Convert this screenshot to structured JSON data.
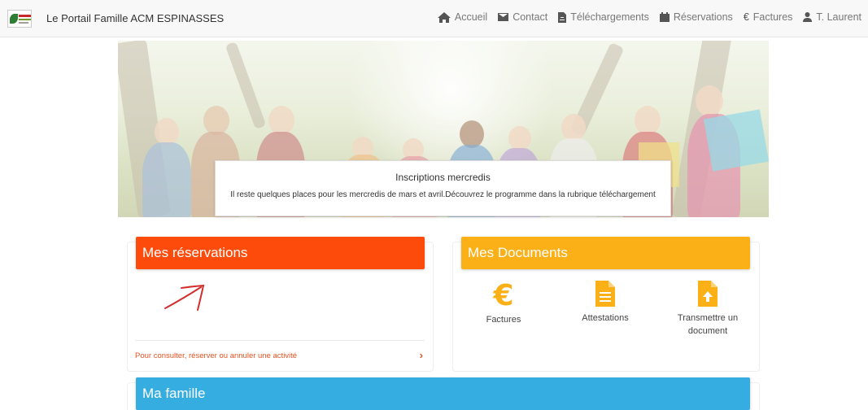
{
  "navbar": {
    "brand_title": "Le Portail Famille ACM ESPINASSES",
    "items": [
      {
        "label": "Accueil",
        "icon": "home-icon"
      },
      {
        "label": "Contact",
        "icon": "envelope-icon"
      },
      {
        "label": "Téléchargements",
        "icon": "file-download-icon"
      },
      {
        "label": "Réservations",
        "icon": "calendar-icon"
      },
      {
        "label": "Factures",
        "icon": "euro-icon"
      },
      {
        "label": "T. Laurent",
        "icon": "user-icon"
      }
    ]
  },
  "banner": {
    "title": "Inscriptions mercredis",
    "message": "Il reste quelques places pour les mercredis de mars et avril.Découvrez le programme dans la rubrique téléchargement"
  },
  "reservations": {
    "title": "Mes réservations",
    "link_text": "Pour consulter, réserver ou annuler une activité",
    "chevron": "›"
  },
  "documents": {
    "title": "Mes Documents",
    "items": [
      {
        "label": "Factures",
        "icon": "euro-icon"
      },
      {
        "label": "Attestations",
        "icon": "document-icon"
      },
      {
        "label": "Transmettre un document",
        "icon": "upload-document-icon"
      }
    ]
  },
  "famille": {
    "title": "Ma famille"
  },
  "colors": {
    "reservations": "#fc4b0b",
    "documents": "#fbb017",
    "famille": "#35ade1",
    "link": "#e55321"
  }
}
